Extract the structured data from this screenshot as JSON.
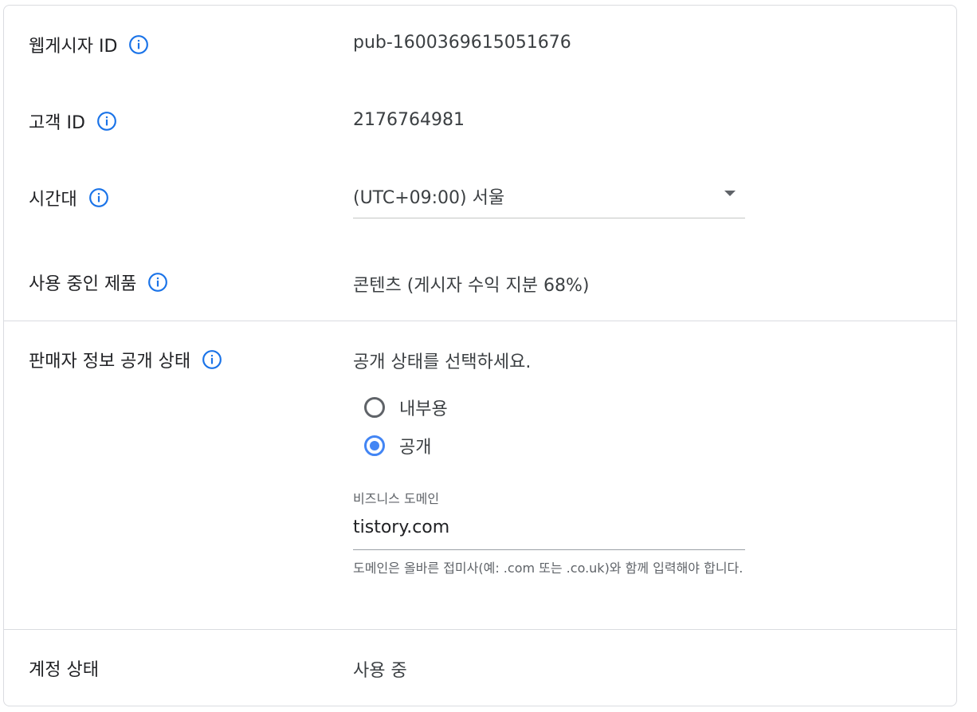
{
  "rows": {
    "website_id": {
      "label": "웹게시자 ID",
      "value": "pub-1600369615051676"
    },
    "customer_id": {
      "label": "고객 ID",
      "value": "2176764981"
    },
    "timezone": {
      "label": "시간대",
      "value": "(UTC+09:00) 서울"
    },
    "products": {
      "label": "사용 중인 제품",
      "value": "콘텐츠 (게시자 수익 지분 68%)"
    },
    "seller_info": {
      "label": "판매자 정보 공개 상태",
      "prompt": "공개 상태를 선택하세요.",
      "options": [
        {
          "label": "내부용",
          "checked": false
        },
        {
          "label": "공개",
          "checked": true
        }
      ],
      "domain_field": {
        "label": "비즈니스 도메인",
        "value": "tistory.com",
        "helper": "도메인은 올바른 접미사(예: .com 또는 .co.uk)와 함께 입력해야 합니다."
      }
    },
    "account_status": {
      "label": "계정 상태",
      "value": "사용 중"
    }
  },
  "colors": {
    "accent": "#4285f4",
    "info_icon": "#1a73e8",
    "divider": "#dadce0"
  }
}
